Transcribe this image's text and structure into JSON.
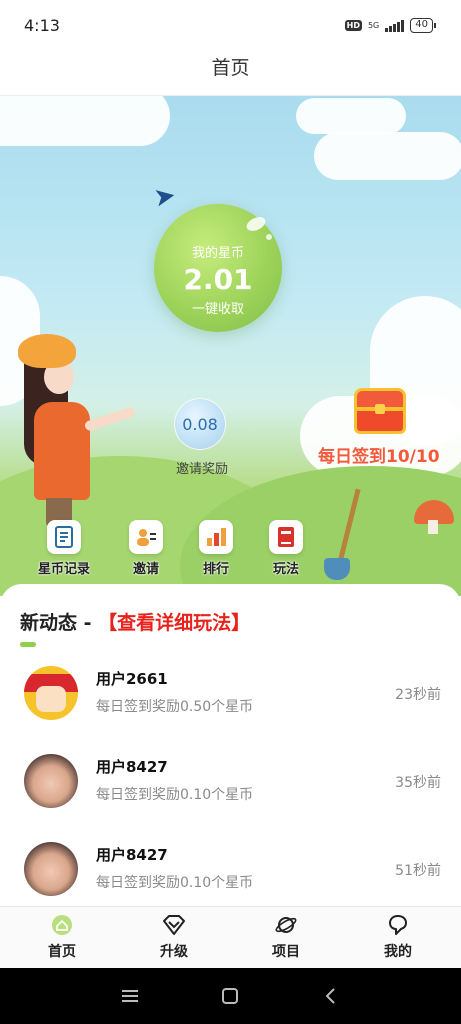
{
  "status_bar": {
    "time": "4:13",
    "hd": "HD",
    "network": "5G",
    "battery": "40"
  },
  "header": {
    "title": "首页"
  },
  "hero": {
    "coin_label": "我的星币",
    "coin_value": "2.01",
    "collect_label": "一键收取",
    "invite_bubble_value": "0.08",
    "invite_reward_label": "邀请奖励",
    "checkin_label": "每日签到10/10"
  },
  "quick_menu": [
    {
      "label": "星币记录",
      "icon": "coin-record-icon"
    },
    {
      "label": "邀请",
      "icon": "invite-icon"
    },
    {
      "label": "排行",
      "icon": "ranking-icon"
    },
    {
      "label": "玩法",
      "icon": "rules-book-icon"
    }
  ],
  "feed": {
    "title": "新动态 - ",
    "link": "【查看详细玩法】",
    "items": [
      {
        "user": "用户2661",
        "text": "每日签到奖励0.50个星币",
        "time": "23秒前"
      },
      {
        "user": "用户8427",
        "text": "每日签到奖励0.10个星币",
        "time": "35秒前"
      },
      {
        "user": "用户8427",
        "text": "每日签到奖励0.10个星币",
        "time": "51秒前"
      }
    ]
  },
  "bottom_nav": [
    {
      "label": "首页",
      "icon": "home-icon",
      "active": true
    },
    {
      "label": "升级",
      "icon": "diamond-icon"
    },
    {
      "label": "项目",
      "icon": "planet-icon"
    },
    {
      "label": "我的",
      "icon": "profile-icon"
    }
  ],
  "colors": {
    "accent_green": "#8fd04b",
    "link_red": "#e8231b",
    "checkin_red": "#f25a3c"
  }
}
